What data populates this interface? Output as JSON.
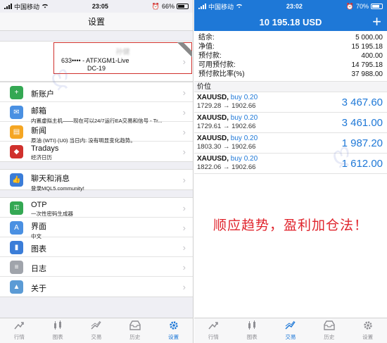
{
  "left": {
    "status": {
      "carrier": "中国移动",
      "time": "23:05",
      "battery": "66%"
    },
    "nav_title": "设置",
    "account": {
      "name": "孙健",
      "line": "633•••• - ATFXGM1-Live",
      "server": "DC-19"
    },
    "menu_group1": [
      {
        "title": "新账户",
        "sub": "",
        "icon": "add-account-icon",
        "color": "#34a853"
      },
      {
        "title": "邮箱",
        "sub": "内置虚拟主机——现在可以24/7运行EA交易和信号 - Tr...",
        "icon": "mail-icon",
        "color": "#4a90e2"
      },
      {
        "title": "新闻",
        "sub": "原油 (WTI) (U0) 当日内: 没有明显变化趋势。",
        "icon": "news-icon",
        "color": "#f5a623"
      },
      {
        "title": "Tradays",
        "sub": "经济日历",
        "icon": "tradays-calendar-icon",
        "color": "#d0312d"
      }
    ],
    "menu_group2": [
      {
        "title": "聊天和消息",
        "sub": "登录MQL5.community!",
        "icon": "chat-icon",
        "color": "#3b7dd8"
      }
    ],
    "menu_group3": [
      {
        "title": "OTP",
        "sub": "一次性密码生成器",
        "icon": "otp-key-icon",
        "color": "#34a853"
      },
      {
        "title": "界面",
        "sub": "中文",
        "icon": "language-icon",
        "color": "#4a90e2"
      },
      {
        "title": "图表",
        "sub": "",
        "icon": "chart-settings-icon",
        "color": "#3b7dd8"
      },
      {
        "title": "日志",
        "sub": "",
        "icon": "journal-icon",
        "color": "#a0a4ab"
      },
      {
        "title": "关于",
        "sub": "",
        "icon": "about-icon",
        "color": "#5b9bd5"
      }
    ],
    "tabs": [
      {
        "label": "行情",
        "icon": "quotes-icon"
      },
      {
        "label": "图表",
        "icon": "charts-icon"
      },
      {
        "label": "交易",
        "icon": "trade-icon"
      },
      {
        "label": "历史",
        "icon": "history-icon"
      },
      {
        "label": "设置",
        "icon": "settings-gear-icon"
      }
    ],
    "active_tab": "设置"
  },
  "right": {
    "status": {
      "carrier": "中国移动",
      "time": "23:02",
      "battery": "70%"
    },
    "balance_title": "10 195.18 USD",
    "summary": [
      {
        "label": "结余:",
        "value": "5 000.00"
      },
      {
        "label": "净值:",
        "value": "15 195.18"
      },
      {
        "label": "预付款:",
        "value": "400.00"
      },
      {
        "label": "可用预付款:",
        "value": "14 795.18"
      },
      {
        "label": "预付款比率(%)",
        "value": "37 988.00"
      }
    ],
    "positions_header": "价位",
    "positions": [
      {
        "symbol": "XAUUSD,",
        "side": "buy 0.20",
        "prices": "1729.28 → 1902.66",
        "profit": "3 467.60"
      },
      {
        "symbol": "XAUUSD,",
        "side": "buy 0.20",
        "prices": "1729.61 → 1902.66",
        "profit": "3 461.00"
      },
      {
        "symbol": "XAUUSD,",
        "side": "buy 0.20",
        "prices": "1803.30 → 1902.66",
        "profit": "1 987.20"
      },
      {
        "symbol": "XAUUSD,",
        "side": "buy 0.20",
        "prices": "1822.06 → 1902.66",
        "profit": "1 612.00"
      }
    ],
    "slogan": "顺应趋势，盈利加仓法！",
    "tabs": [
      {
        "label": "行情",
        "icon": "quotes-icon"
      },
      {
        "label": "图表",
        "icon": "charts-icon"
      },
      {
        "label": "交易",
        "icon": "trade-icon"
      },
      {
        "label": "历史",
        "icon": "history-icon"
      },
      {
        "label": "设置",
        "icon": "settings-gear-icon"
      }
    ],
    "active_tab": "交易"
  },
  "colors": {
    "accent": "#1e78d7",
    "highlight_box": "#d0312d",
    "slogan": "#e0252d"
  }
}
